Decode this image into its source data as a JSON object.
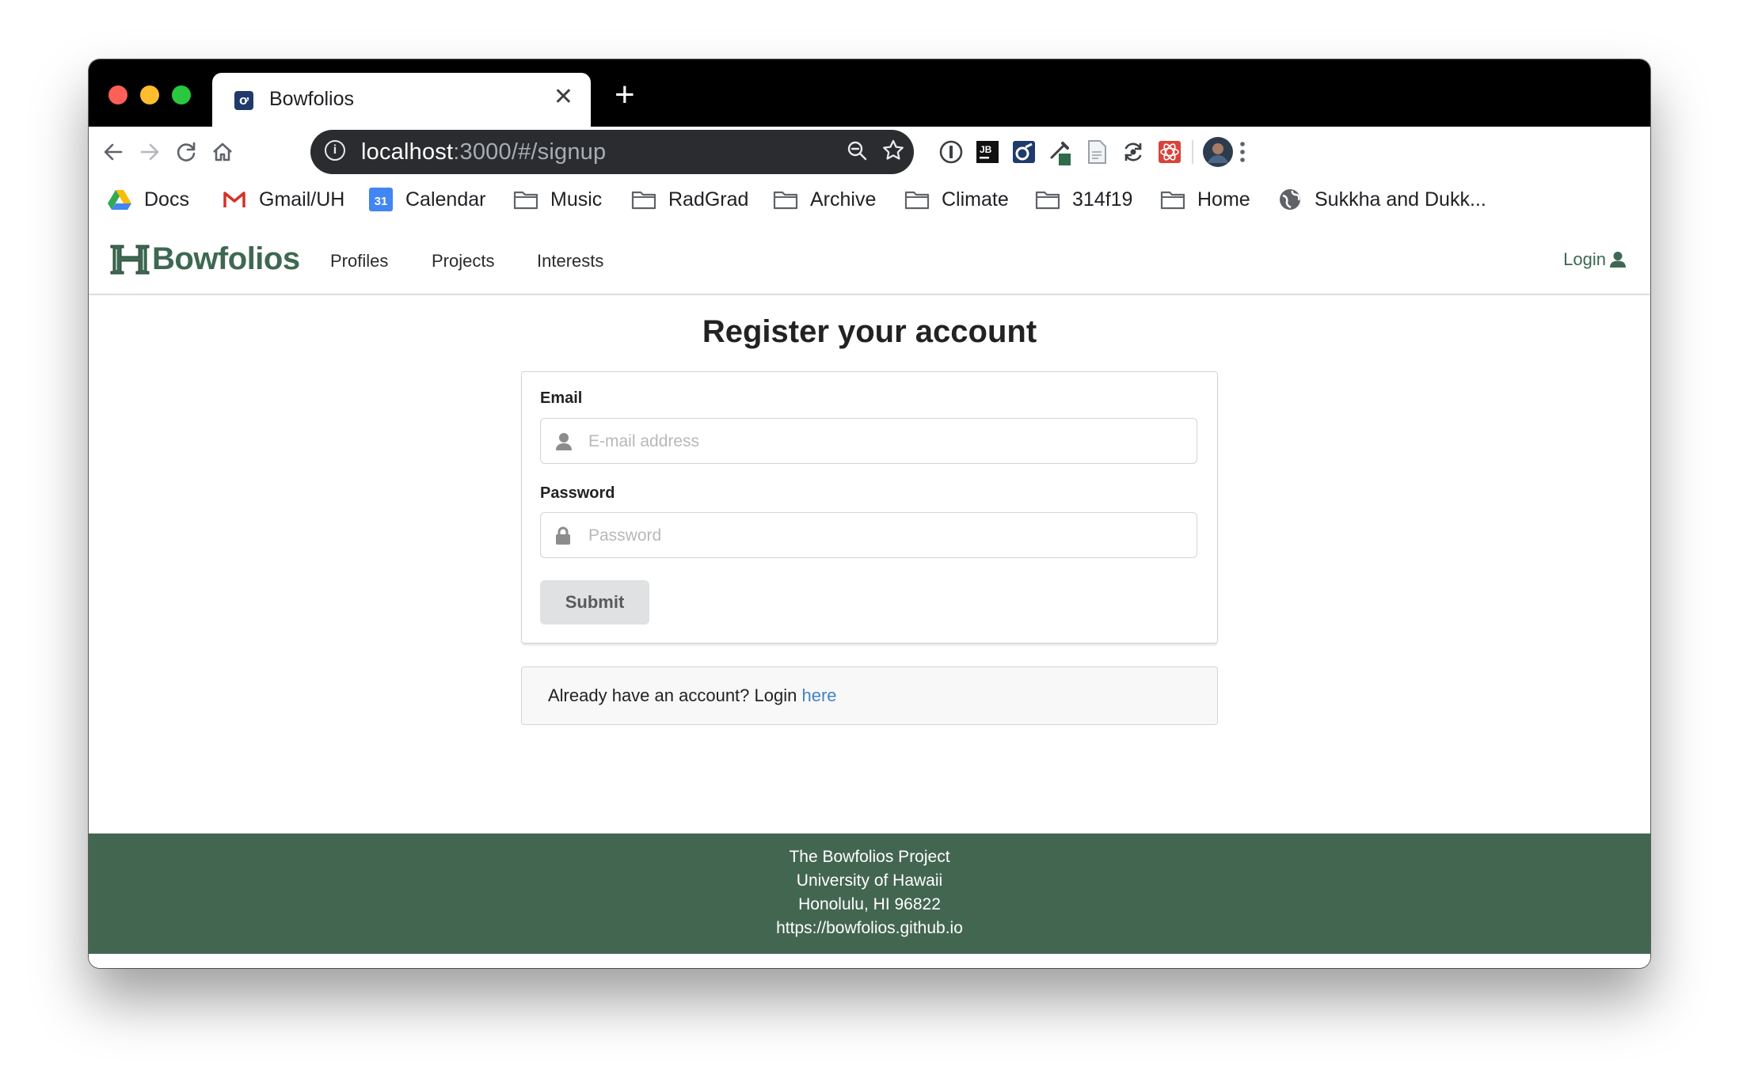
{
  "browser": {
    "tab_title": "Bowfolios",
    "favicon_glyph": "ơ",
    "url_host": "localhost",
    "url_path": ":3000/#/signup",
    "info_glyph": "i"
  },
  "bookmarks": [
    {
      "label": "Docs",
      "icon": "google-drive-icon"
    },
    {
      "label": "Gmail/UH",
      "icon": "gmail-icon"
    },
    {
      "label": "Calendar",
      "icon": "calendar-icon",
      "icon_text": "31"
    },
    {
      "label": "Music",
      "icon": "folder-icon"
    },
    {
      "label": "RadGrad",
      "icon": "folder-icon"
    },
    {
      "label": "Archive",
      "icon": "folder-icon"
    },
    {
      "label": "Climate",
      "icon": "folder-icon"
    },
    {
      "label": "314f19",
      "icon": "folder-icon"
    },
    {
      "label": "Home",
      "icon": "folder-icon"
    },
    {
      "label": "Sukkha and Dukk...",
      "icon": "globe-icon"
    }
  ],
  "site": {
    "brand": "Bowfolios",
    "nav": [
      "Profiles",
      "Projects",
      "Interests"
    ],
    "login": "Login"
  },
  "form": {
    "title": "Register your account",
    "email_label": "Email",
    "email_placeholder": "E-mail address",
    "password_label": "Password",
    "password_placeholder": "Password",
    "submit": "Submit"
  },
  "message": {
    "text": "Already have an account? Login",
    "link": "here"
  },
  "footer": {
    "line1": "The Bowfolios Project",
    "line2": "University of Hawaii",
    "line3": "Honolulu, HI 96822",
    "line4": "https://bowfolios.github.io"
  },
  "colors": {
    "brand_green": "#3e6851",
    "footer_green": "#436651",
    "link_blue": "#4183c4"
  }
}
